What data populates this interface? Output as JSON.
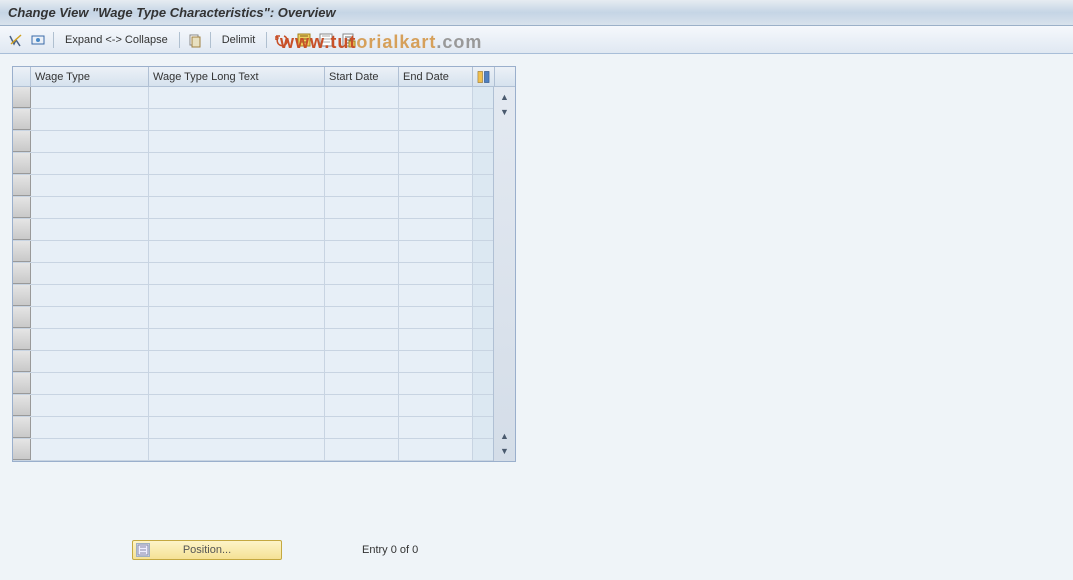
{
  "title": "Change View \"Wage Type Characteristics\": Overview",
  "toolbar": {
    "expand_collapse": "Expand <-> Collapse",
    "delimit": "Delimit"
  },
  "table": {
    "columns": {
      "wage_type": "Wage Type",
      "long_text": "Wage Type Long Text",
      "start_date": "Start Date",
      "end_date": "End Date"
    },
    "row_count": 17,
    "rows": []
  },
  "footer": {
    "position_label": "Position...",
    "entry_text": "Entry 0 of 0"
  },
  "watermark": {
    "part1": "www.",
    "part2": "tut",
    "part3": "orialkart",
    "part4": ".com"
  }
}
